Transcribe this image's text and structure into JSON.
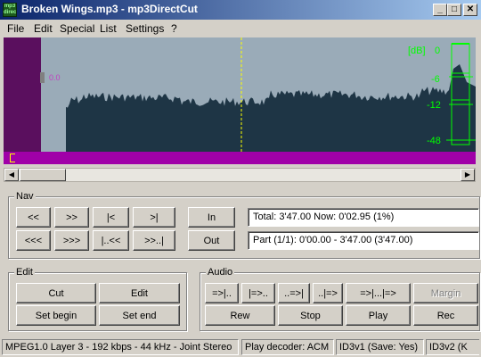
{
  "window": {
    "title": "Broken Wings.mp3 - mp3DirectCut",
    "icon_text": "mp3 direct cut",
    "controls": {
      "minimize": "_",
      "maximize": "□",
      "close": "✕"
    }
  },
  "menu": [
    "File",
    "Edit",
    "Special",
    "List",
    "Settings",
    "?"
  ],
  "waveform": {
    "level_label": "0.0",
    "db_label": "[dB]",
    "db_ticks": [
      "0",
      "-6",
      "-12",
      "-48"
    ],
    "colors": {
      "background": "#9aabb8",
      "wave": "#1e3545",
      "selection": "#5a0f5e",
      "meter": "#00ff00",
      "cursor": "#ffff00",
      "position_bar": "#a000a8"
    },
    "cursor_position": 0.505
  },
  "nav": {
    "label": "Nav",
    "buttons_row1": [
      "<<",
      ">>",
      "|<",
      ">|"
    ],
    "buttons_row2": [
      "<<<",
      ">>>",
      "|..<<",
      ">>..|"
    ],
    "in": "In",
    "out": "Out",
    "info_total": "Total: 3'47.00   Now: 0'02.95   (1%)",
    "info_part": "Part (1/1): 0'00.00 - 3'47.00 (3'47.00)"
  },
  "edit": {
    "label": "Edit",
    "cut": "Cut",
    "edit": "Edit",
    "set_begin": "Set begin",
    "set_end": "Set end"
  },
  "audio": {
    "label": "Audio",
    "row1": [
      "=>|..",
      "|=>..",
      "..=>|",
      "..|=>",
      "=>|...|=>"
    ],
    "margin": "Margin",
    "rew": "Rew",
    "stop": "Stop",
    "play": "Play",
    "rec": "Rec"
  },
  "status": {
    "format": "MPEG1.0 Layer 3 - 192 kbps - 44 kHz - Joint Stereo",
    "decoder": "Play decoder: ACM",
    "id3v1": "ID3v1 (Save: Yes)",
    "id3v2": "ID3v2 (K"
  }
}
